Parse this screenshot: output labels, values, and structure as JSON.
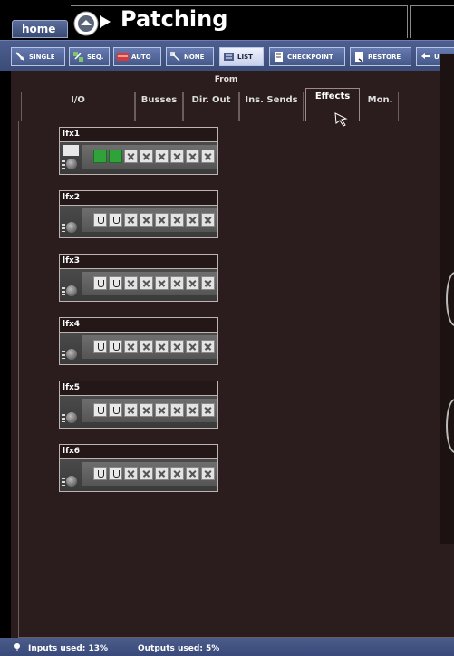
{
  "header": {
    "home_label": "home",
    "title": "Patching"
  },
  "toolbar": {
    "buttons": [
      {
        "label": "SINGLE",
        "icon": "single-patch-icon"
      },
      {
        "label": "SEQ.",
        "icon": "sequential-patch-icon"
      },
      {
        "label": "AUTO",
        "icon": "auto-patch-icon"
      },
      {
        "label": "NONE",
        "icon": "no-patch-icon"
      },
      {
        "label": "LIST",
        "icon": "list-icon"
      },
      {
        "label": "CHECKPOINT",
        "icon": "checkpoint-icon"
      },
      {
        "label": "RESTORE",
        "icon": "restore-icon"
      },
      {
        "label": "UNDO",
        "icon": "undo-icon"
      }
    ],
    "selected": "LIST"
  },
  "from_label": "From",
  "tabs": [
    {
      "label": "I/O"
    },
    {
      "label": "Busses"
    },
    {
      "label": "Dir. Out"
    },
    {
      "label": "Ins. Sends"
    },
    {
      "label": "Effects"
    },
    {
      "label": "Mon."
    }
  ],
  "active_tab": "Effects",
  "effects": [
    {
      "name": "lfx1",
      "slots": [
        "active",
        "active",
        "x",
        "x",
        "x",
        "x",
        "x",
        "x"
      ]
    },
    {
      "name": "lfx2",
      "slots": [
        "ok",
        "ok",
        "x",
        "x",
        "x",
        "x",
        "x",
        "x"
      ]
    },
    {
      "name": "lfx3",
      "slots": [
        "ok",
        "ok",
        "x",
        "x",
        "x",
        "x",
        "x",
        "x"
      ]
    },
    {
      "name": "lfx4",
      "slots": [
        "ok",
        "ok",
        "x",
        "x",
        "x",
        "x",
        "x",
        "x"
      ]
    },
    {
      "name": "lfx5",
      "slots": [
        "ok",
        "ok",
        "x",
        "x",
        "x",
        "x",
        "x",
        "x"
      ]
    },
    {
      "name": "lfx6",
      "slots": [
        "ok",
        "ok",
        "x",
        "x",
        "x",
        "x",
        "x",
        "x"
      ]
    }
  ],
  "status": {
    "inputs_used": "Inputs used: 13%",
    "outputs_used": "Outputs used: 5%"
  },
  "colors": {
    "panel_bg": "#2b1d1d",
    "toolbar_bg": "#4d5f8f",
    "active_slot": "#2fa33a"
  }
}
